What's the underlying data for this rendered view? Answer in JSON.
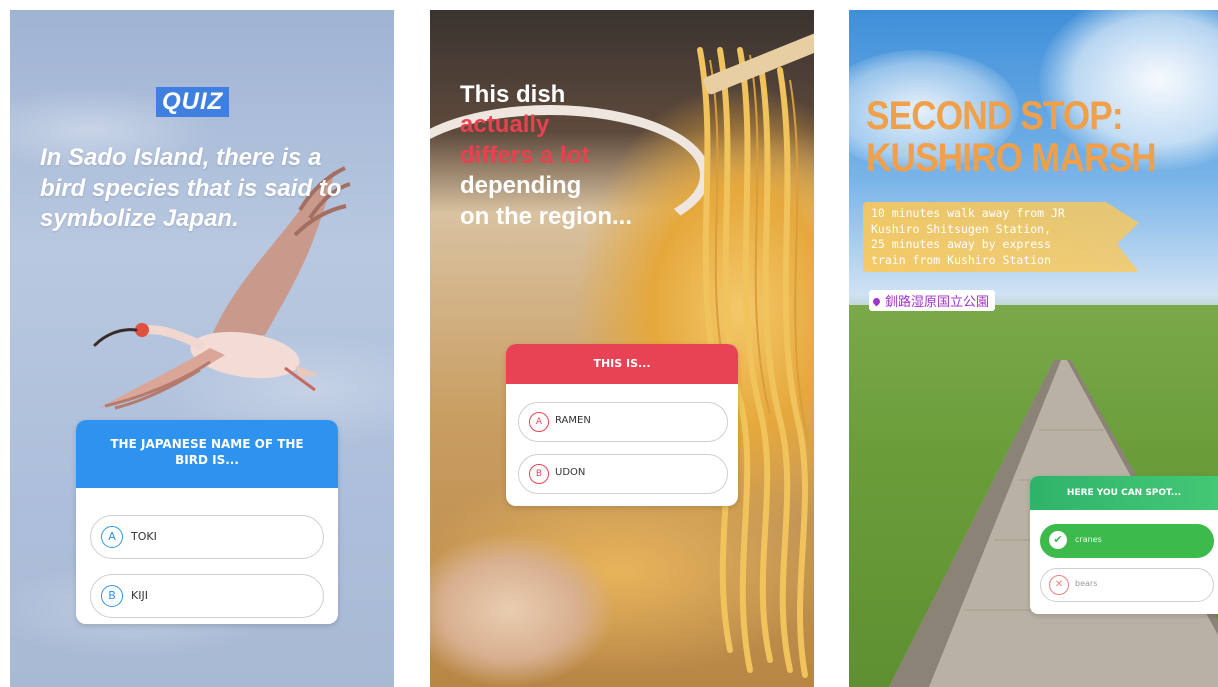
{
  "story1": {
    "tag": "QUIZ",
    "question": "In Sado Island, there is a bird species that is said to symbolize Japan.",
    "poll": {
      "header": "THE JAPANESE NAME OF THE BIRD IS...",
      "options": [
        {
          "letter": "A",
          "text": "TOKI"
        },
        {
          "letter": "B",
          "text": "KIJI"
        }
      ],
      "accent_color": "#2d93ee"
    }
  },
  "story2": {
    "question": {
      "line1": "This dish",
      "line2": "actually",
      "line3": "differs a lot",
      "line4": "depending",
      "line5": "on the region..."
    },
    "poll": {
      "header": "THIS IS...",
      "options": [
        {
          "letter": "A",
          "text": "RAMEN"
        },
        {
          "letter": "B",
          "text": "UDON"
        }
      ],
      "accent_color": "#e84355"
    }
  },
  "story3": {
    "title_line1": "SECOND STOP:",
    "title_line2": "KUSHIRO MARSH",
    "access": "10 minutes walk away from JR\nKushiro Shitsugen Station,\n25 minutes away by express\ntrain from Kushiro Station",
    "location": "釧路湿原国立公園",
    "location_icon": "location-pin-icon",
    "poll": {
      "header": "HERE YOU CAN SPOT...",
      "options": [
        {
          "icon": "✔",
          "text": "cranes",
          "state": "correct"
        },
        {
          "icon": "✕",
          "text": "bears",
          "state": "wrong"
        }
      ],
      "accent_color": "#3cba4b"
    }
  }
}
